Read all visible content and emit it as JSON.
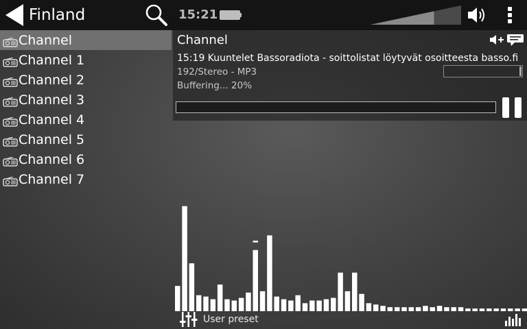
{
  "header": {
    "title": "Finland",
    "clock": "15:21",
    "volume_level": 0.7,
    "icons": {
      "back": "back-arrow-icon",
      "search": "search-icon",
      "battery": "battery-icon",
      "volume": "volume-bar-icon",
      "speaker": "speaker-icon",
      "menu": "overflow-menu-icon"
    }
  },
  "channels": [
    {
      "label": "Channel",
      "selected": true
    },
    {
      "label": "Channel 1",
      "selected": false
    },
    {
      "label": "Channel 2",
      "selected": false
    },
    {
      "label": "Channel 3",
      "selected": false
    },
    {
      "label": "Channel 4",
      "selected": false
    },
    {
      "label": "Channel 5",
      "selected": false
    },
    {
      "label": "Channel 6",
      "selected": false
    },
    {
      "label": "Channel 7",
      "selected": false
    }
  ],
  "player": {
    "title": "Channel",
    "now_playing": "15:19 Kuuntelet Bassoradiota - soittolistat löytyvät osoitteesta basso.fi",
    "stream_info": "192/Stereo - MP3",
    "buffer_status": "Buffering... 20%",
    "buffer_progress": 0.2
  },
  "equalizer": {
    "preset": "User preset",
    "levels": [
      0.19,
      0.79,
      0.36,
      0.12,
      0.11,
      0.09,
      0.2,
      0.09,
      0.08,
      0.1,
      0.14,
      0.46,
      0.15,
      0.57,
      0.11,
      0.09,
      0.08,
      0.12,
      0.06,
      0.08,
      0.08,
      0.09,
      0.1,
      0.29,
      0.15,
      0.29,
      0.13,
      0.06,
      0.05,
      0.04,
      0.03,
      0.03,
      0.03,
      0.03,
      0.03,
      0.04,
      0.03,
      0.04,
      0.03,
      0.03,
      0.03,
      0.02,
      0.02,
      0.02,
      0.02,
      0.02,
      0.02,
      0.02,
      0.02,
      0.02
    ],
    "peaks": [
      {
        "band": 11,
        "level": 0.53
      }
    ]
  },
  "colors": {
    "topbar": "#141414",
    "selected": "#707070",
    "bar": "#ffffff"
  }
}
